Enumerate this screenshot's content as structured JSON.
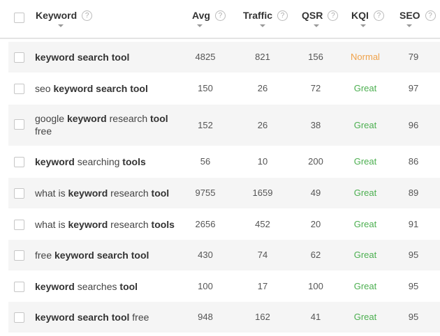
{
  "header": {
    "keyword": "Keyword",
    "avg": "Avg",
    "traffic": "Traffic",
    "qsr": "QSR",
    "kqi": "KQI",
    "seo": "SEO",
    "help_glyph": "?"
  },
  "colors": {
    "normal": "#f0a24a",
    "great": "#4caf50"
  },
  "rows": [
    {
      "keyword_parts": [
        [
          "keyword search tool",
          true
        ]
      ],
      "avg": "4825",
      "traffic": "821",
      "qsr": "156",
      "kqi": "Normal",
      "kqi_class": "normal",
      "seo": "79"
    },
    {
      "keyword_parts": [
        [
          "seo ",
          false
        ],
        [
          "keyword search tool",
          true
        ]
      ],
      "avg": "150",
      "traffic": "26",
      "qsr": "72",
      "kqi": "Great",
      "kqi_class": "great",
      "seo": "97"
    },
    {
      "keyword_parts": [
        [
          "google ",
          false
        ],
        [
          "keyword",
          true
        ],
        [
          " research ",
          false
        ],
        [
          "tool",
          true
        ],
        [
          " free",
          false
        ]
      ],
      "avg": "152",
      "traffic": "26",
      "qsr": "38",
      "kqi": "Great",
      "kqi_class": "great",
      "seo": "96"
    },
    {
      "keyword_parts": [
        [
          "keyword",
          true
        ],
        [
          " searching ",
          false
        ],
        [
          "tools",
          true
        ]
      ],
      "avg": "56",
      "traffic": "10",
      "qsr": "200",
      "kqi": "Great",
      "kqi_class": "great",
      "seo": "86"
    },
    {
      "keyword_parts": [
        [
          "what is ",
          false
        ],
        [
          "keyword",
          true
        ],
        [
          " research ",
          false
        ],
        [
          "tool",
          true
        ]
      ],
      "avg": "9755",
      "traffic": "1659",
      "qsr": "49",
      "kqi": "Great",
      "kqi_class": "great",
      "seo": "89"
    },
    {
      "keyword_parts": [
        [
          "what is ",
          false
        ],
        [
          "keyword",
          true
        ],
        [
          " research ",
          false
        ],
        [
          "tools",
          true
        ]
      ],
      "avg": "2656",
      "traffic": "452",
      "qsr": "20",
      "kqi": "Great",
      "kqi_class": "great",
      "seo": "91"
    },
    {
      "keyword_parts": [
        [
          "free ",
          false
        ],
        [
          "keyword search tool",
          true
        ]
      ],
      "avg": "430",
      "traffic": "74",
      "qsr": "62",
      "kqi": "Great",
      "kqi_class": "great",
      "seo": "95"
    },
    {
      "keyword_parts": [
        [
          "keyword",
          true
        ],
        [
          " searches ",
          false
        ],
        [
          "tool",
          true
        ]
      ],
      "avg": "100",
      "traffic": "17",
      "qsr": "100",
      "kqi": "Great",
      "kqi_class": "great",
      "seo": "95"
    },
    {
      "keyword_parts": [
        [
          "keyword search tool",
          true
        ],
        [
          " free",
          false
        ]
      ],
      "avg": "948",
      "traffic": "162",
      "qsr": "41",
      "kqi": "Great",
      "kqi_class": "great",
      "seo": "95"
    }
  ]
}
